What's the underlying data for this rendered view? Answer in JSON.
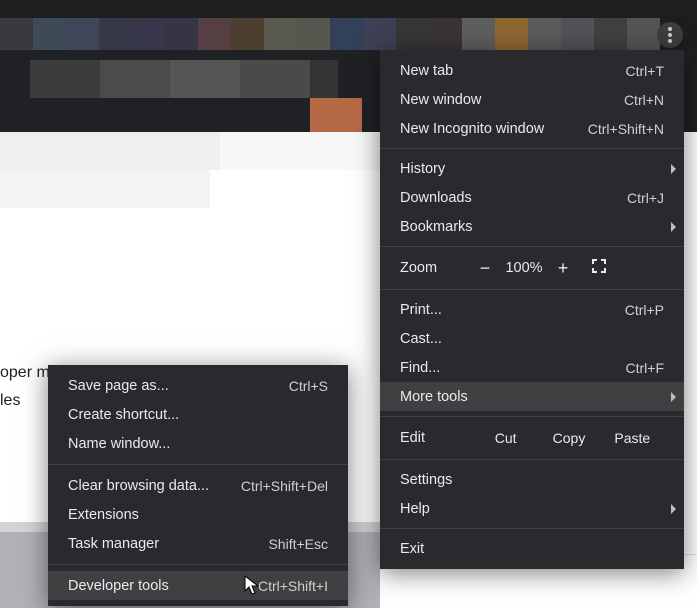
{
  "page_text": {
    "line1": "oper mode by",
    "line2": "les"
  },
  "menu": {
    "new_tab": {
      "label": "New tab",
      "shortcut": "Ctrl+T"
    },
    "new_window": {
      "label": "New window",
      "shortcut": "Ctrl+N"
    },
    "new_incognito": {
      "label": "New Incognito window",
      "shortcut": "Ctrl+Shift+N"
    },
    "history": {
      "label": "History"
    },
    "downloads": {
      "label": "Downloads",
      "shortcut": "Ctrl+J"
    },
    "bookmarks": {
      "label": "Bookmarks"
    },
    "zoom": {
      "label": "Zoom",
      "minus": "−",
      "value": "100%",
      "plus": "+"
    },
    "print": {
      "label": "Print...",
      "shortcut": "Ctrl+P"
    },
    "cast": {
      "label": "Cast..."
    },
    "find": {
      "label": "Find...",
      "shortcut": "Ctrl+F"
    },
    "more_tools": {
      "label": "More tools"
    },
    "edit": {
      "label": "Edit",
      "cut": "Cut",
      "copy": "Copy",
      "paste": "Paste"
    },
    "settings": {
      "label": "Settings"
    },
    "help": {
      "label": "Help"
    },
    "exit": {
      "label": "Exit"
    }
  },
  "submenu": {
    "save_page": {
      "label": "Save page as...",
      "shortcut": "Ctrl+S"
    },
    "create_shortcut": {
      "label": "Create shortcut..."
    },
    "name_window": {
      "label": "Name window..."
    },
    "clear_browsing": {
      "label": "Clear browsing data...",
      "shortcut": "Ctrl+Shift+Del"
    },
    "extensions": {
      "label": "Extensions"
    },
    "task_manager": {
      "label": "Task manager",
      "shortcut": "Shift+Esc"
    },
    "developer_tools": {
      "label": "Developer tools",
      "shortcut": "Ctrl+Shift+I"
    }
  }
}
